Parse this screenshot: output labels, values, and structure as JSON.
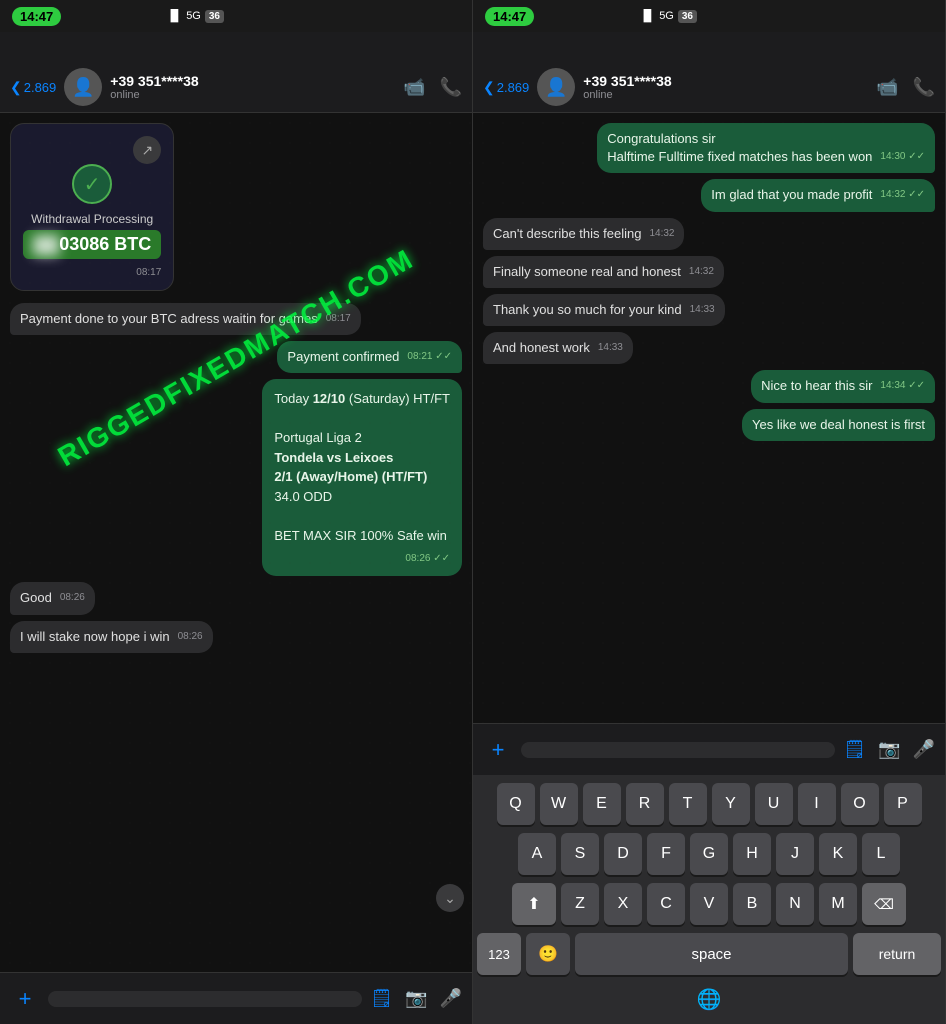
{
  "status": {
    "time_left": "14:47",
    "time_right": "14:47",
    "signal": "5G",
    "battery_left": "36",
    "battery_right": "36"
  },
  "left_panel": {
    "back_count": "2.869",
    "contact_name": "+39 351****38",
    "contact_status": "online",
    "watermark": "RIGGEDFIXEDMATCH.COM",
    "messages": [
      {
        "type": "btc",
        "title": "Withdrawal Processing",
        "amount": "03086 BTC",
        "time": "08:17"
      },
      {
        "type": "received",
        "text": "Payment done to your BTC adress waitin for games",
        "time": "08:17"
      },
      {
        "type": "sent",
        "text": "Payment confirmed",
        "time": "08:21",
        "ticks": "✓✓"
      },
      {
        "type": "sent_info",
        "text": "Today 12/10 (Saturday) HT/FT\n\nPortugal Liga 2\nTondela vs Leixoes\n2/1 (Away/Home) (HT/FT)\n34.0 ODD\n\nBET MAX SIR 100% Safe win",
        "time": "08:26",
        "ticks": "✓✓"
      },
      {
        "type": "received",
        "text": "Good",
        "time": "08:26"
      },
      {
        "type": "received",
        "text": "I will stake now hope i win",
        "time": "08:26"
      }
    ],
    "input_placeholder": ""
  },
  "right_panel": {
    "back_count": "2.869",
    "contact_name": "+39 351****38",
    "contact_status": "online",
    "messages": [
      {
        "type": "sent",
        "text": "Congratulations sir\nHalftime Fulltime fixed matches has been won",
        "time": "14:30",
        "ticks": "✓✓"
      },
      {
        "type": "sent",
        "text": "Im glad that you made profit",
        "time": "14:32",
        "ticks": "✓✓"
      },
      {
        "type": "received",
        "text": "Can't describe this feeling",
        "time": "14:32"
      },
      {
        "type": "received",
        "text": "Finally someone real and honest",
        "time": "14:32"
      },
      {
        "type": "received",
        "text": "Thank you so much for your kind",
        "time": "14:33"
      },
      {
        "type": "received",
        "text": "And honest work",
        "time": "14:33"
      },
      {
        "type": "sent",
        "text": "Nice to hear this sir",
        "time": "14:34",
        "ticks": "✓✓"
      },
      {
        "type": "sent_partial",
        "text": "Yes like we deal honest is first",
        "time": ""
      }
    ],
    "input_placeholder": "",
    "keyboard": {
      "row1": [
        "Q",
        "W",
        "E",
        "R",
        "T",
        "Y",
        "U",
        "I",
        "O",
        "P"
      ],
      "row2": [
        "A",
        "S",
        "D",
        "F",
        "G",
        "H",
        "J",
        "K",
        "L"
      ],
      "row3": [
        "Z",
        "X",
        "C",
        "V",
        "B",
        "N",
        "M"
      ],
      "bottom": {
        "num": "123",
        "space": "space",
        "return": "return"
      }
    }
  }
}
